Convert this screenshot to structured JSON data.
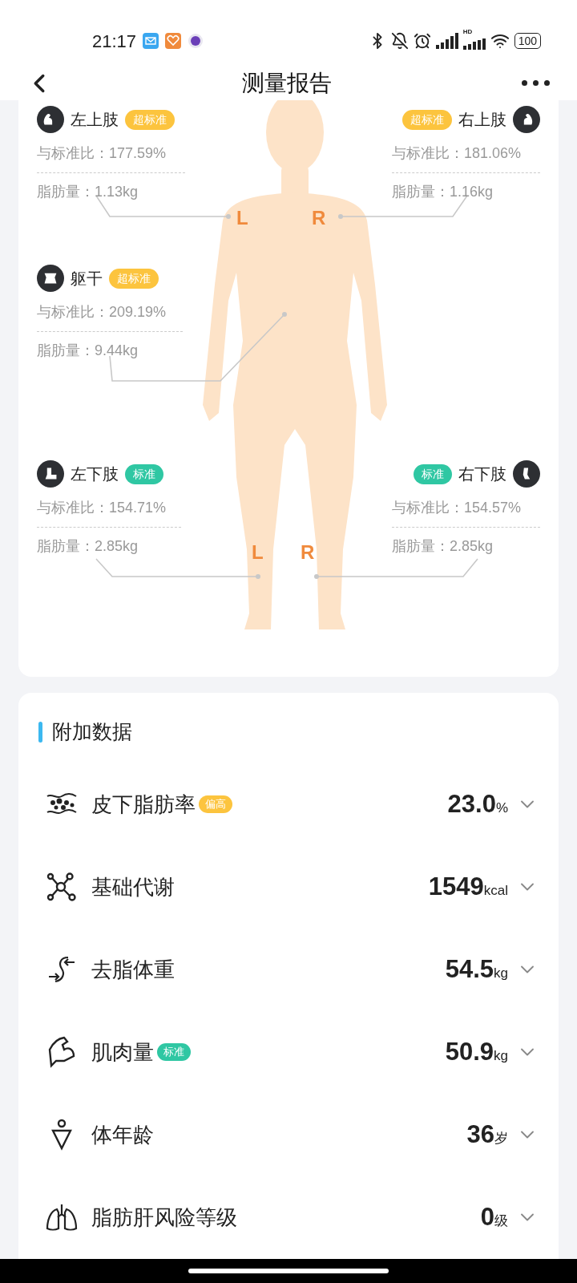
{
  "status_bar": {
    "time": "21:17",
    "network_label": "HD",
    "battery": "100"
  },
  "header": {
    "title": "测量报告"
  },
  "segments": [
    {
      "name": "左上肢",
      "badge": {
        "text": "超标准",
        "kind": "over"
      },
      "ratio": "与标准比：177.59%",
      "fat": "脂肪量：1.13kg"
    },
    {
      "name": "右上肢",
      "badge": {
        "text": "超标准",
        "kind": "over"
      },
      "ratio": "与标准比：181.06%",
      "fat": "脂肪量：1.16kg"
    },
    {
      "name": "躯干",
      "badge": {
        "text": "超标准",
        "kind": "over"
      },
      "ratio": "与标准比：209.19%",
      "fat": "脂肪量：9.44kg"
    },
    {
      "name": "左下肢",
      "badge": {
        "text": "标准",
        "kind": "standard"
      },
      "ratio": "与标准比：154.71%",
      "fat": "脂肪量：2.85kg"
    },
    {
      "name": "右下肢",
      "badge": {
        "text": "标准",
        "kind": "standard"
      },
      "ratio": "与标准比：154.57%",
      "fat": "脂肪量：2.85kg"
    }
  ],
  "figure_markers": [
    "L",
    "R",
    "L",
    "R"
  ],
  "additional": {
    "title": "附加数据",
    "items": [
      {
        "label": "皮下脂肪率",
        "badge": {
          "text": "偏高",
          "kind": "high"
        },
        "value": "23.0",
        "unit": "%"
      },
      {
        "label": "基础代谢",
        "value": "1549",
        "unit": "kcal"
      },
      {
        "label": "去脂体重",
        "value": "54.5",
        "unit": "kg"
      },
      {
        "label": "肌肉量",
        "badge": {
          "text": "标准",
          "kind": "standard"
        },
        "value": "50.9",
        "unit": "kg"
      },
      {
        "label": "体年龄",
        "value": "36",
        "unit": "岁"
      },
      {
        "label": "脂肪肝风险等级",
        "value": "0",
        "unit": "级"
      }
    ]
  }
}
